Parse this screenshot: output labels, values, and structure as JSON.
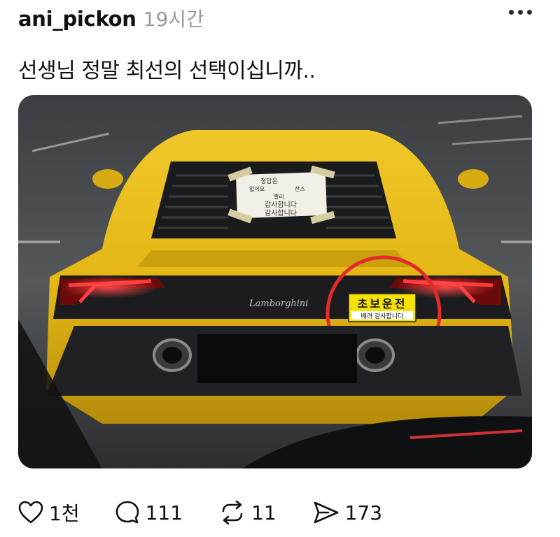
{
  "post": {
    "username": "ani_pickon",
    "timestamp": "19시간",
    "text": "선생님 정말 최선의 선택이십니까..",
    "image": {
      "paper_sign_lines": [
        "정답은",
        "없어요",
        "찬스",
        "빨리",
        "감사합니다",
        "감사합니다"
      ],
      "sticker_main": "초보운전",
      "sticker_sub": "배려 감사합니다",
      "badge_brand": "Lamborghini",
      "highlight_color": "#e32a2a",
      "car_color": "#e3b514"
    },
    "actions": {
      "likes": "1천",
      "replies": "111",
      "reposts": "11",
      "shares": "173"
    }
  }
}
